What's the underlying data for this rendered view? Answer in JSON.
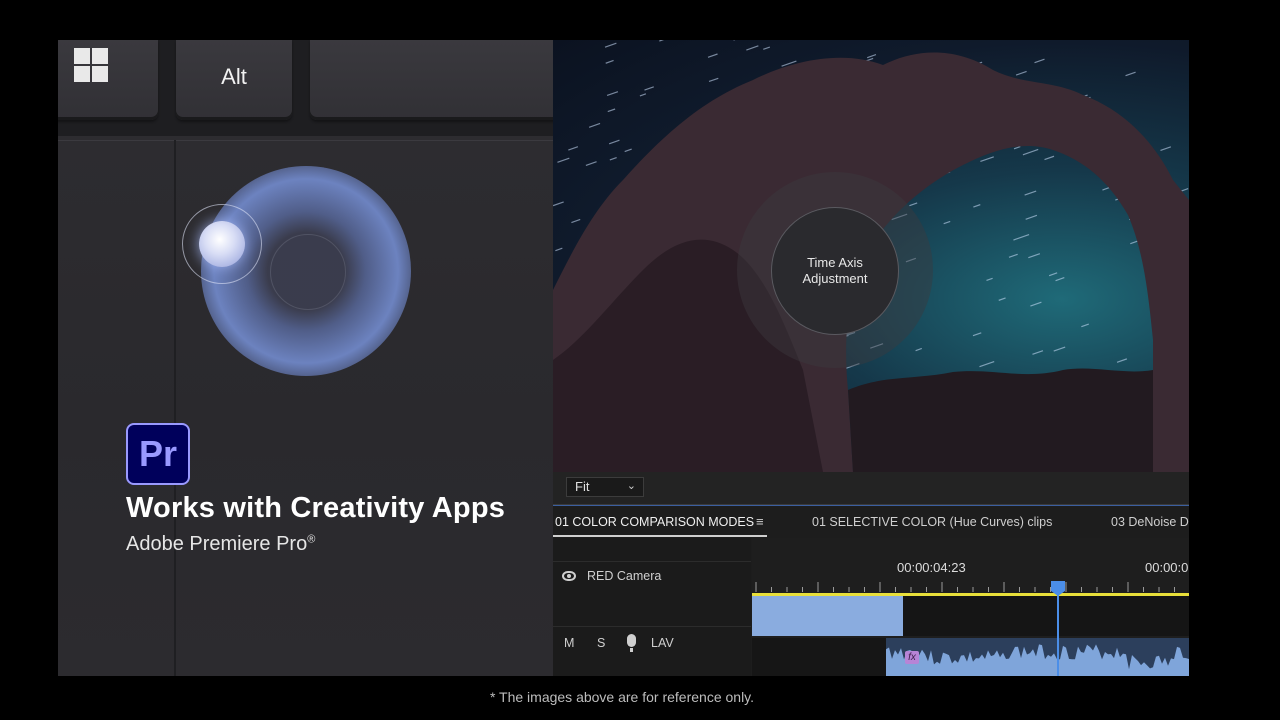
{
  "keyboard": {
    "win_key_icon": "windows-logo-icon",
    "alt_label": "Alt"
  },
  "promo": {
    "app_logo_text": "Pr",
    "headline": "Works with Creativity Apps",
    "app_name": "Adobe Premiere Pro",
    "registered_mark": "®"
  },
  "preview": {
    "dial_label_line1": "Time Axis",
    "dial_label_line2": "Adjustment"
  },
  "editor": {
    "zoom_select": "Fit",
    "tabs": [
      {
        "label": "01 COLOR COMPARISON MODES",
        "active": true
      },
      {
        "label": "01 SELECTIVE COLOR (Hue Curves) clips",
        "active": false
      },
      {
        "label": "03 DeNoise D",
        "active": false
      }
    ],
    "tracks": {
      "video_track_name": "RED Camera",
      "audio_track_name": "LAV",
      "mute_label": "M",
      "solo_label": "S"
    },
    "timecodes": [
      "00:00:04:23",
      "00:00:0"
    ],
    "fx_badge": "fx",
    "colors": {
      "clip_video": "#8aacdf",
      "clip_audio": "#7fa5da",
      "work_area": "#e8df3a",
      "playhead": "#4b8ee8"
    }
  },
  "disclaimer": "* The images above are for reference only."
}
